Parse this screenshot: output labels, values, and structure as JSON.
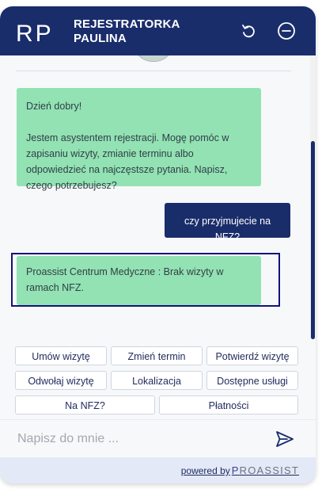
{
  "header": {
    "logo_text": "RP",
    "title": "REJESTRATORKA PAULINA",
    "refresh_icon": "refresh-icon",
    "minimize_icon": "minimize-icon"
  },
  "messages": [
    {
      "sender": "bot",
      "lines": [
        "Dzień dobry!",
        "Jestem asystentem rejestracji. Mogę pomóc w zapisaniu wizyty, zmianie terminu albo odpowiedzieć na najczęstsze pytania. Napisz, czego potrzebujesz?"
      ]
    },
    {
      "sender": "user",
      "text": "czy przyjmujecie na NFZ?"
    },
    {
      "sender": "bot",
      "text": "Proassist Centrum Medyczne : Brak wizyty w ramach NFZ."
    }
  ],
  "quick_replies": [
    "Umów wizytę",
    "Zmień termin",
    "Potwierdź wizytę",
    "Odwołaj wizytę",
    "Lokalizacja",
    "Dostępne usługi",
    "Na NFZ?",
    "Płatności"
  ],
  "input": {
    "placeholder": "Napisz do mnie ...",
    "value": "",
    "send_icon": "send-icon"
  },
  "footer": {
    "powered_by": "powered by",
    "brand_p": "P",
    "brand_rest": "ROASSIST"
  },
  "colors": {
    "header_bg": "#1a2d6b",
    "bot_bubble": "#92e2b3",
    "user_bubble": "#1a2d6b",
    "focus_frame": "#12127a",
    "footer_bg": "#e4e9f8"
  }
}
